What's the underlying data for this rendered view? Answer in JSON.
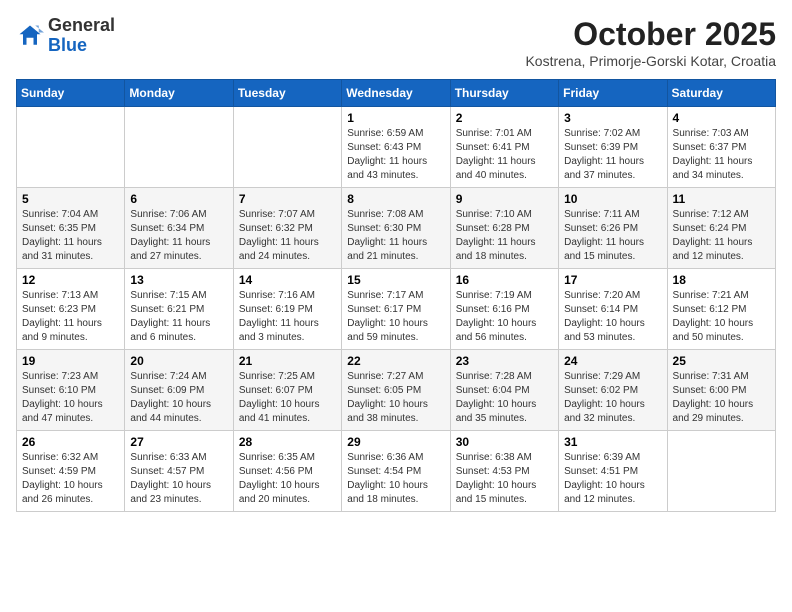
{
  "header": {
    "logo_general": "General",
    "logo_blue": "Blue",
    "month": "October 2025",
    "location": "Kostrena, Primorje-Gorski Kotar, Croatia"
  },
  "days_of_week": [
    "Sunday",
    "Monday",
    "Tuesday",
    "Wednesday",
    "Thursday",
    "Friday",
    "Saturday"
  ],
  "weeks": [
    [
      {
        "day": "",
        "info": ""
      },
      {
        "day": "",
        "info": ""
      },
      {
        "day": "",
        "info": ""
      },
      {
        "day": "1",
        "info": "Sunrise: 6:59 AM\nSunset: 6:43 PM\nDaylight: 11 hours\nand 43 minutes."
      },
      {
        "day": "2",
        "info": "Sunrise: 7:01 AM\nSunset: 6:41 PM\nDaylight: 11 hours\nand 40 minutes."
      },
      {
        "day": "3",
        "info": "Sunrise: 7:02 AM\nSunset: 6:39 PM\nDaylight: 11 hours\nand 37 minutes."
      },
      {
        "day": "4",
        "info": "Sunrise: 7:03 AM\nSunset: 6:37 PM\nDaylight: 11 hours\nand 34 minutes."
      }
    ],
    [
      {
        "day": "5",
        "info": "Sunrise: 7:04 AM\nSunset: 6:35 PM\nDaylight: 11 hours\nand 31 minutes."
      },
      {
        "day": "6",
        "info": "Sunrise: 7:06 AM\nSunset: 6:34 PM\nDaylight: 11 hours\nand 27 minutes."
      },
      {
        "day": "7",
        "info": "Sunrise: 7:07 AM\nSunset: 6:32 PM\nDaylight: 11 hours\nand 24 minutes."
      },
      {
        "day": "8",
        "info": "Sunrise: 7:08 AM\nSunset: 6:30 PM\nDaylight: 11 hours\nand 21 minutes."
      },
      {
        "day": "9",
        "info": "Sunrise: 7:10 AM\nSunset: 6:28 PM\nDaylight: 11 hours\nand 18 minutes."
      },
      {
        "day": "10",
        "info": "Sunrise: 7:11 AM\nSunset: 6:26 PM\nDaylight: 11 hours\nand 15 minutes."
      },
      {
        "day": "11",
        "info": "Sunrise: 7:12 AM\nSunset: 6:24 PM\nDaylight: 11 hours\nand 12 minutes."
      }
    ],
    [
      {
        "day": "12",
        "info": "Sunrise: 7:13 AM\nSunset: 6:23 PM\nDaylight: 11 hours\nand 9 minutes."
      },
      {
        "day": "13",
        "info": "Sunrise: 7:15 AM\nSunset: 6:21 PM\nDaylight: 11 hours\nand 6 minutes."
      },
      {
        "day": "14",
        "info": "Sunrise: 7:16 AM\nSunset: 6:19 PM\nDaylight: 11 hours\nand 3 minutes."
      },
      {
        "day": "15",
        "info": "Sunrise: 7:17 AM\nSunset: 6:17 PM\nDaylight: 10 hours\nand 59 minutes."
      },
      {
        "day": "16",
        "info": "Sunrise: 7:19 AM\nSunset: 6:16 PM\nDaylight: 10 hours\nand 56 minutes."
      },
      {
        "day": "17",
        "info": "Sunrise: 7:20 AM\nSunset: 6:14 PM\nDaylight: 10 hours\nand 53 minutes."
      },
      {
        "day": "18",
        "info": "Sunrise: 7:21 AM\nSunset: 6:12 PM\nDaylight: 10 hours\nand 50 minutes."
      }
    ],
    [
      {
        "day": "19",
        "info": "Sunrise: 7:23 AM\nSunset: 6:10 PM\nDaylight: 10 hours\nand 47 minutes."
      },
      {
        "day": "20",
        "info": "Sunrise: 7:24 AM\nSunset: 6:09 PM\nDaylight: 10 hours\nand 44 minutes."
      },
      {
        "day": "21",
        "info": "Sunrise: 7:25 AM\nSunset: 6:07 PM\nDaylight: 10 hours\nand 41 minutes."
      },
      {
        "day": "22",
        "info": "Sunrise: 7:27 AM\nSunset: 6:05 PM\nDaylight: 10 hours\nand 38 minutes."
      },
      {
        "day": "23",
        "info": "Sunrise: 7:28 AM\nSunset: 6:04 PM\nDaylight: 10 hours\nand 35 minutes."
      },
      {
        "day": "24",
        "info": "Sunrise: 7:29 AM\nSunset: 6:02 PM\nDaylight: 10 hours\nand 32 minutes."
      },
      {
        "day": "25",
        "info": "Sunrise: 7:31 AM\nSunset: 6:00 PM\nDaylight: 10 hours\nand 29 minutes."
      }
    ],
    [
      {
        "day": "26",
        "info": "Sunrise: 6:32 AM\nSunset: 4:59 PM\nDaylight: 10 hours\nand 26 minutes."
      },
      {
        "day": "27",
        "info": "Sunrise: 6:33 AM\nSunset: 4:57 PM\nDaylight: 10 hours\nand 23 minutes."
      },
      {
        "day": "28",
        "info": "Sunrise: 6:35 AM\nSunset: 4:56 PM\nDaylight: 10 hours\nand 20 minutes."
      },
      {
        "day": "29",
        "info": "Sunrise: 6:36 AM\nSunset: 4:54 PM\nDaylight: 10 hours\nand 18 minutes."
      },
      {
        "day": "30",
        "info": "Sunrise: 6:38 AM\nSunset: 4:53 PM\nDaylight: 10 hours\nand 15 minutes."
      },
      {
        "day": "31",
        "info": "Sunrise: 6:39 AM\nSunset: 4:51 PM\nDaylight: 10 hours\nand 12 minutes."
      },
      {
        "day": "",
        "info": ""
      }
    ]
  ]
}
